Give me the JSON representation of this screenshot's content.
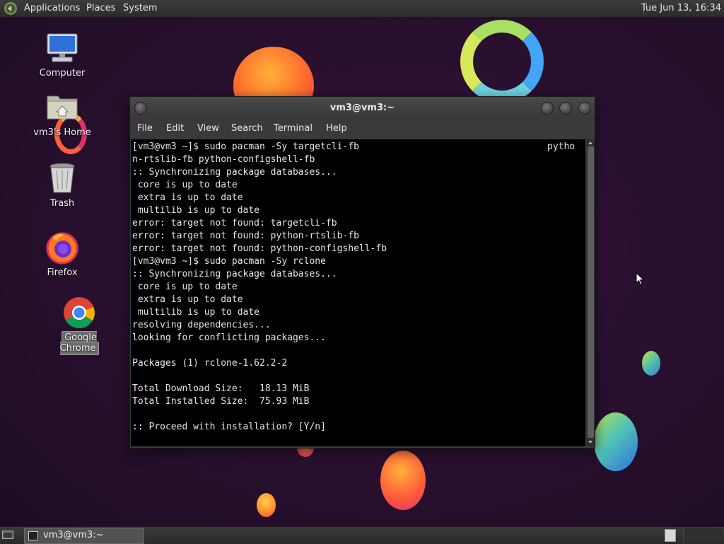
{
  "top_panel": {
    "menus": [
      "Applications",
      "Places",
      "System"
    ],
    "clock": "Tue Jun 13, 16:34"
  },
  "desktop": {
    "icons": [
      {
        "label": "Computer",
        "icon": "computer-icon"
      },
      {
        "label": "vm3's Home",
        "icon": "home-folder-icon"
      },
      {
        "label": "Trash",
        "icon": "trash-icon"
      },
      {
        "label": "Firefox",
        "icon": "firefox-icon"
      },
      {
        "label": "Google Chrome",
        "icon": "chrome-icon",
        "selected": true
      }
    ]
  },
  "terminal": {
    "title": "vm3@vm3:~",
    "menu": [
      "File",
      "Edit",
      "View",
      "Search",
      "Terminal",
      "Help"
    ],
    "lines": [
      "[vm3@vm3 ~]$ sudo pacman -Sy targetcli-fb                                  pytho",
      "n-rtslib-fb python-configshell-fb",
      ":: Synchronizing package databases...",
      " core is up to date",
      " extra is up to date",
      " multilib is up to date",
      "error: target not found: targetcli-fb",
      "error: target not found: python-rtslib-fb",
      "error: target not found: python-configshell-fb",
      "[vm3@vm3 ~]$ sudo pacman -Sy rclone",
      ":: Synchronizing package databases...",
      " core is up to date",
      " extra is up to date",
      " multilib is up to date",
      "resolving dependencies...",
      "looking for conflicting packages...",
      "",
      "Packages (1) rclone-1.62.2-2",
      "",
      "Total Download Size:   18.13 MiB",
      "Total Installed Size:  75.93 MiB",
      "",
      ":: Proceed with installation? [Y/n]"
    ]
  },
  "taskbar": {
    "task_label": "vm3@vm3:~"
  },
  "colors": {
    "desktop_bg": "#2a1030",
    "panel_bg": "#2f2f2f",
    "terminal_bg": "#000000",
    "terminal_fg": "#e6e6e6"
  }
}
